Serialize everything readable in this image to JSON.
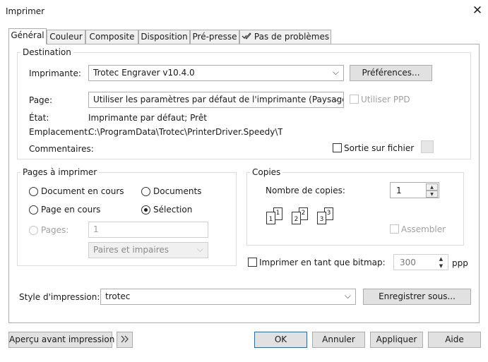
{
  "window": {
    "title": "Imprimer"
  },
  "tabs": [
    {
      "label": "Général",
      "active": true
    },
    {
      "label": "Couleur"
    },
    {
      "label": "Composite"
    },
    {
      "label": "Disposition"
    },
    {
      "label": "Pré-presse"
    },
    {
      "label": "Pas de problèmes",
      "icon": "check-pencil-icon"
    }
  ],
  "destination": {
    "legend": "Destination",
    "printer_label": "Imprimante:",
    "printer_value": "Trotec Engraver v10.4.0",
    "preferences_button": "Préférences...",
    "page_label": "Page:",
    "page_value": "Utiliser les paramètres par défaut de l'imprimante (Paysage)",
    "use_ppd_label": "Utiliser PPD",
    "status_label": "État:",
    "status_value": "Imprimante par défaut; Prêt",
    "location_label": "Emplacement:",
    "location_value": "C:\\ProgramData\\Trotec\\PrinterDriver.Speedy\\Trote",
    "comments_label": "Commentaires:",
    "print_to_file_label": "Sortie sur fichier"
  },
  "pages": {
    "legend": "Pages à imprimer",
    "current_document": "Document en cours",
    "documents": "Documents",
    "current_page": "Page en cours",
    "selection": "Sélection",
    "pages_label": "Pages:",
    "pages_value": "1",
    "odd_even_value": "Paires et impaires"
  },
  "copies": {
    "legend": "Copies",
    "count_label": "Nombre de copies:",
    "count_value": "1",
    "collate_label": "Assembler",
    "collate_pages": [
      {
        "back": "1",
        "front": "1"
      },
      {
        "back": "2",
        "front": "2"
      },
      {
        "back": "3",
        "front": "3"
      }
    ]
  },
  "bitmap": {
    "label": "Imprimer en tant que bitmap:",
    "dpi_value": "300",
    "unit": "ppp"
  },
  "print_style": {
    "label": "Style d'impression:",
    "value": "trotec",
    "save_as_button": "Enregistrer sous..."
  },
  "footer": {
    "preview_button": "Aperçu avant impression",
    "ok_button": "OK",
    "cancel_button": "Annuler",
    "apply_button": "Appliquer",
    "help_button": "Aide"
  },
  "colors": {
    "accent": "#0078d7",
    "border": "#adadad",
    "button_face": "#e1e1e1"
  }
}
